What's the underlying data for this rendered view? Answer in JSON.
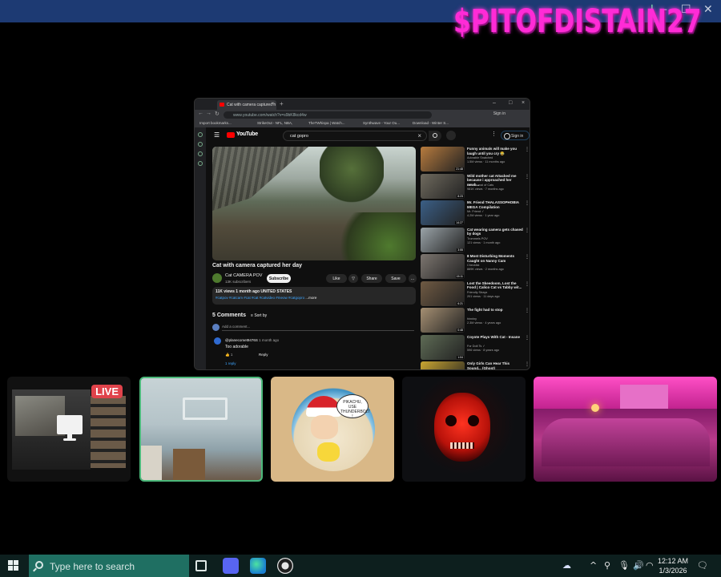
{
  "overlay": {
    "title": "$PITOFDISTAIN27"
  },
  "window_controls": {
    "download": "↓",
    "minimize": "–",
    "maximize": "☐",
    "close": "✕"
  },
  "browser": {
    "tab_title": "Cat with camera captured h",
    "url": "www.youtube.com/watch?v=s9bK8kcd4w",
    "sign_in": "Sign in",
    "bookmarks": [
      "Import bookmarks...",
      "StrikeOut - NFL, NBA,",
      "TheTWhispa | Watch...",
      "Synthwave - Your Ou...",
      "Download - Winter S..."
    ]
  },
  "youtube": {
    "logo": "YouTube",
    "search_query": "cat gopro",
    "sign_in": "Sign in",
    "video_title": "Cat with camera captured her day",
    "channel": "Cat CAMERA POV",
    "subscribers": "13K subscribers",
    "subscribe": "Subscribe",
    "like": "Like",
    "share": "Share",
    "save": "Save",
    "views_line": "11K views 1 month ago UNITED STATES",
    "tags_line": "#catpov #catcam #cat #cat #catvideo #meow #catgopro",
    "more": "...more",
    "comments_count": "5 Comments",
    "sort_by": "Sort by",
    "add_comment": "Add a comment...",
    "comment": {
      "user": "@planecomet9476S",
      "age": "1 month ago",
      "text": "Too adorable",
      "likes": "1",
      "reply": "Reply",
      "replies": "1 reply"
    },
    "recommendations": [
      {
        "title": "Funny animals will make you laugh until you cry 😂",
        "channel": "Adorable Snatched",
        "meta": "1.5M views · 11 months ago",
        "duration": "21:48",
        "color": "#b77b3e"
      },
      {
        "title": "Wild mother cat Attacked me because i approached her newb...",
        "channel": "The Journal of Cats",
        "meta": "981K views · 7 months ago",
        "duration": "8:23",
        "color": "#6f6a5e"
      },
      {
        "title": "Mr. Friend THALASSOPHOBIA MEGA Compilation",
        "channel": "Mr. Friend ✓",
        "meta": "4.2M views · 1 year ago",
        "duration": "14:27",
        "color": "#3b5f86"
      },
      {
        "title": "Cat wearing camera gets chased by dogs",
        "channel": "Trommels POV",
        "meta": "121 views · 1 month ago",
        "duration": "3:55",
        "color": "#9aa3a8"
      },
      {
        "title": "8 Most Disturbing Moments Caught on Nanny Cam",
        "channel": "Checklist",
        "meta": "889K views · 2 months ago",
        "duration": "15:11",
        "color": "#7d7670"
      },
      {
        "title": "Lost the Skeedoom, Lost the Food | Calico Cat vs Tabby wit...",
        "channel": "Friendly Strays",
        "meta": "201 views · 11 days ago",
        "duration": "6:21",
        "color": "#6f5a43"
      },
      {
        "title": "The fight had to stop",
        "channel": "hinniny",
        "meta": "2.3M views · 4 years ago",
        "duration": "0:48",
        "color": "#a58f72"
      },
      {
        "title": "Coyote Plays With Cat - Insane",
        "channel": "For Dolt Ts ✓",
        "meta": "596 views · 8 years ago",
        "duration": "1:04",
        "color": "#5e6b55"
      },
      {
        "title": "Only Girls Can Hear This Sound... (Ghost)",
        "channel": "",
        "meta": "",
        "duration": "",
        "color": "#c9a531"
      }
    ]
  },
  "tiles": {
    "live_badge": "LIVE",
    "sticker_text": "PIKACHU, USE THUNDERBOLT !"
  },
  "taskbar": {
    "search_placeholder": "Type here to search",
    "time": "12:12 AM",
    "date": "1/3/2026"
  },
  "colors": {
    "accent": "#4bb87a",
    "live": "#e0434b",
    "overlay_text": "#ff2bd6",
    "youtube_red": "#ff0000"
  }
}
